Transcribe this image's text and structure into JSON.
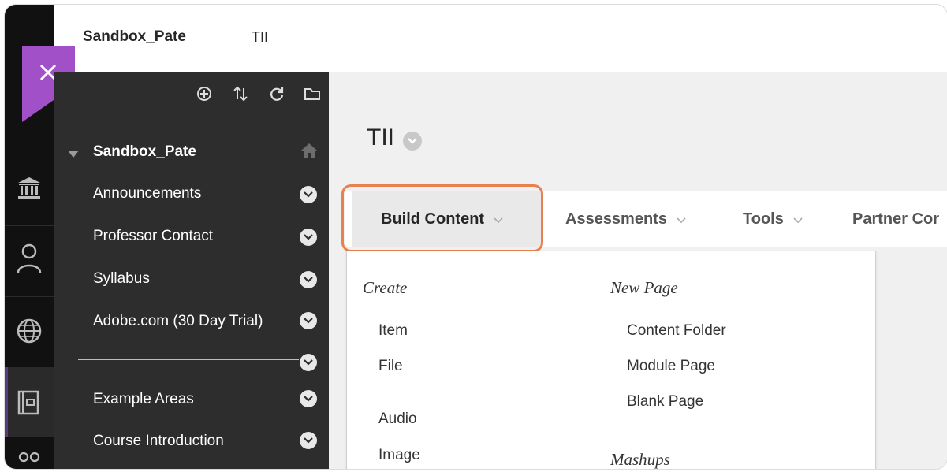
{
  "header": {
    "course_name": "Sandbox_Pate",
    "breadcrumb": "TII"
  },
  "rail": {
    "icons": [
      "institution-icon",
      "user-icon",
      "globe-icon",
      "courses-icon",
      "groups-icon"
    ]
  },
  "course_menu": {
    "tools": [
      "add-icon",
      "sort-icon",
      "refresh-icon",
      "folder-icon"
    ],
    "title": "Sandbox_Pate",
    "items": [
      {
        "label": "Announcements"
      },
      {
        "label": "Professor Contact"
      },
      {
        "label": "Syllabus"
      },
      {
        "label": "Adobe.com (30 Day Trial)"
      },
      {
        "label": "Example Areas"
      },
      {
        "label": "Course Introduction"
      }
    ]
  },
  "content": {
    "title": "TII",
    "action_bar": {
      "build_content": "Build Content",
      "assessments": "Assessments",
      "tools": "Tools",
      "partner_content": "Partner Cor"
    }
  },
  "dropdown": {
    "create_heading": "Create",
    "create_items_top": [
      "Item",
      "File"
    ],
    "create_items_bottom": [
      "Audio",
      "Image"
    ],
    "new_page_heading": "New Page",
    "new_page_items": [
      "Content Folder",
      "Module Page",
      "Blank Page"
    ],
    "mashups_heading": "Mashups"
  },
  "colors": {
    "accent_purple": "#a150c8",
    "highlight_orange": "#e8804f",
    "menu_bg": "#2d2d2d",
    "rail_bg": "#111111"
  }
}
